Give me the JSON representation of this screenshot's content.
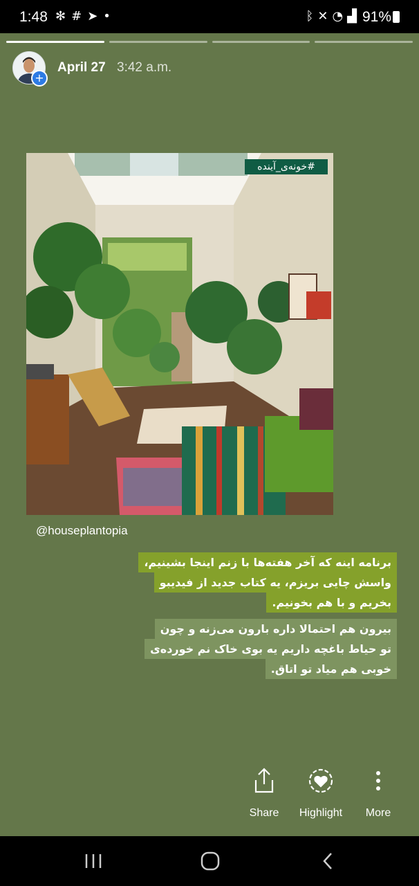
{
  "status_bar": {
    "time": "1:48",
    "left_icons": [
      "pinwheel-icon",
      "slack-icon",
      "telegram-icon",
      "dot-icon"
    ],
    "right_icons": [
      "bluetooth-icon",
      "mute-icon",
      "wifi-icon",
      "signal-icon"
    ],
    "battery": "91%"
  },
  "story": {
    "segments_total": 4,
    "active_segment": 1,
    "date": "April 27",
    "time": "3:42 a.m.",
    "hashtag": "#خونه‌ی_آینده",
    "credit": "@houseplantopia",
    "text_block_1": [
      "برنامه اینه که آخر هفته‌ها با زنم اینجا بشینیم،",
      "واسش چایی بریزم، یه کتاب جدید از فیدیبو",
      "بخریم و با هم بخونیم."
    ],
    "text_block_2": [
      "بیرون هم احتمالا داره بارون می‌زنه و چون",
      "تو حیاط باغچه داریم یه بوی خاک نم خورده‌ی",
      "خوبی هم میاد تو اتاق."
    ]
  },
  "actions": {
    "share": "Share",
    "highlight": "Highlight",
    "more": "More"
  },
  "nav": [
    "recents-icon",
    "home-icon",
    "back-icon"
  ],
  "colors": {
    "background": "#64774a",
    "text_highlight_1": "#85a12b",
    "text_highlight_2": "#7e9460",
    "hashtag_bg": "#0f5c44"
  }
}
